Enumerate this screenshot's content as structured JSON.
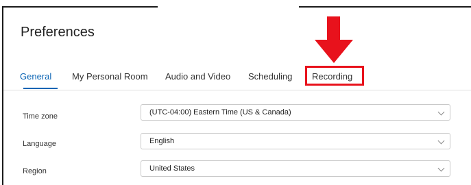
{
  "page": {
    "title": "Preferences"
  },
  "tabs": [
    {
      "label": "General",
      "active": true
    },
    {
      "label": "My Personal Room",
      "active": false
    },
    {
      "label": "Audio and Video",
      "active": false
    },
    {
      "label": "Scheduling",
      "active": false
    },
    {
      "label": "Recording",
      "active": false,
      "highlighted": true
    }
  ],
  "fields": {
    "time_zone": {
      "label": "Time zone",
      "value": "(UTC-04:00) Eastern Time (US & Canada)"
    },
    "language": {
      "label": "Language",
      "value": "English"
    },
    "region": {
      "label": "Region",
      "value": "United States"
    }
  },
  "colors": {
    "accent": "#0a64b4",
    "annotation": "#e8121c",
    "frame": "#1a1a1a"
  },
  "icons": {
    "annotation_arrow": "arrow-down-icon",
    "dropdown": "chevron-down-icon"
  }
}
